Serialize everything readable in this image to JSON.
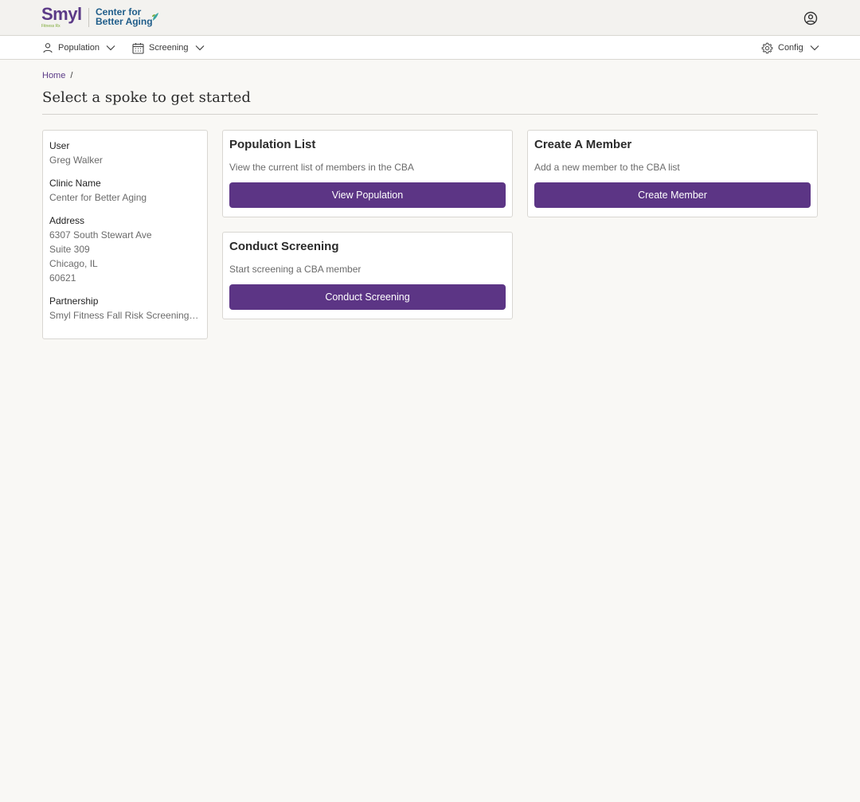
{
  "header": {
    "brand_name": "Smyl",
    "brand_tagline": "Fitness Rx",
    "partner_line1": "Center for",
    "partner_line2": "Better Aging",
    "account_icon": "user-circle-icon"
  },
  "nav": {
    "population_label": "Population",
    "screening_label": "Screening",
    "config_label": "Config"
  },
  "breadcrumb": {
    "home": "Home",
    "separator": "/"
  },
  "page": {
    "title": "Select a spoke to get started"
  },
  "info": {
    "user_label": "User",
    "user_value": "Greg Walker",
    "clinic_label": "Clinic Name",
    "clinic_value": "Center for Better Aging",
    "address_label": "Address",
    "address_line1": "6307 South Stewart Ave",
    "address_line2": "Suite 309",
    "address_line3": "Chicago, IL",
    "address_line4": "60621",
    "partnership_label": "Partnership",
    "partnership_value": "Smyl Fitness Fall Risk Screening Program"
  },
  "cards": {
    "population": {
      "title": "Population List",
      "description": "View the current list of members in the CBA",
      "button": "View Population"
    },
    "create": {
      "title": "Create A Member",
      "description": "Add a new member to the CBA list",
      "button": "Create Member"
    },
    "screening": {
      "title": "Conduct Screening",
      "description": "Start screening a CBA member",
      "button": "Conduct Screening"
    }
  },
  "colors": {
    "brand_purple": "#5c3585",
    "partner_blue": "#1f5d8a",
    "page_bg": "#f9f8f5"
  }
}
